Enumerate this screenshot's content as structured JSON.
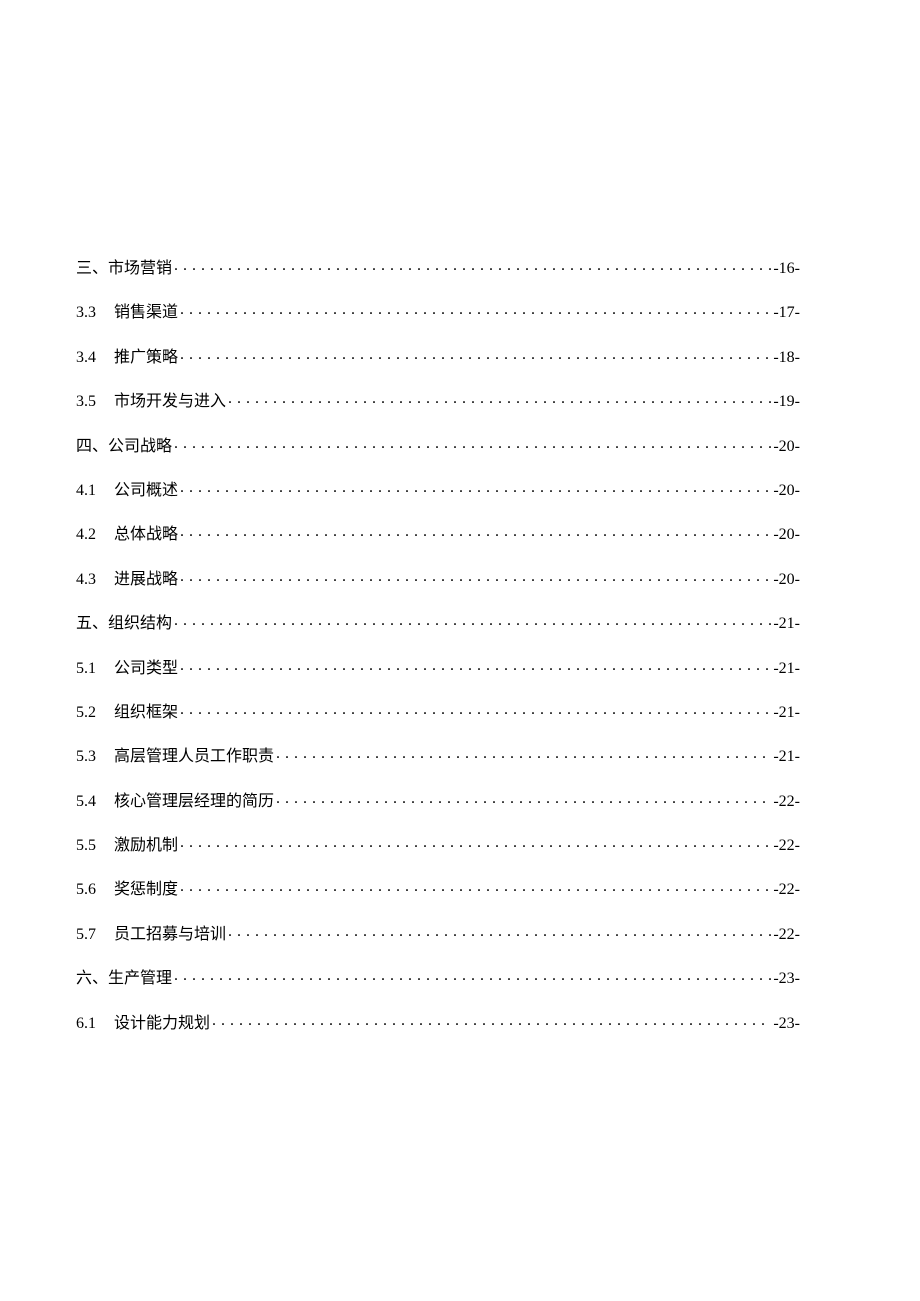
{
  "toc": [
    {
      "number": "三、",
      "title": "市场营销",
      "page": "-16-",
      "hasGap": false
    },
    {
      "number": "3.3",
      "title": "销售渠道",
      "page": "-17-",
      "hasGap": true
    },
    {
      "number": "3.4",
      "title": "推广策略",
      "page": "-18-",
      "hasGap": true
    },
    {
      "number": "3.5",
      "title": "市场开发与进入",
      "page": "-19-",
      "hasGap": true
    },
    {
      "number": "四、",
      "title": "公司战略",
      "page": "-20-",
      "hasGap": false
    },
    {
      "number": "4.1",
      "title": "公司概述",
      "page": "-20-",
      "hasGap": true
    },
    {
      "number": "4.2",
      "title": "总体战略",
      "page": "-20-",
      "hasGap": true
    },
    {
      "number": "4.3",
      "title": "进展战略",
      "page": "-20-",
      "hasGap": true
    },
    {
      "number": "五、",
      "title": "组织结构",
      "page": "-21-",
      "hasGap": false
    },
    {
      "number": "5.1",
      "title": "公司类型",
      "page": "-21-",
      "hasGap": true
    },
    {
      "number": "5.2",
      "title": "组织框架",
      "page": "-21-",
      "hasGap": true
    },
    {
      "number": "5.3",
      "title": "高层管理人员工作职责",
      "page": "-21-",
      "hasGap": true
    },
    {
      "number": "5.4",
      "title": "核心管理层经理的简历",
      "page": "-22-",
      "hasGap": true
    },
    {
      "number": "5.5",
      "title": "激励机制",
      "page": "-22-",
      "hasGap": true
    },
    {
      "number": "5.6",
      "title": "奖惩制度",
      "page": "-22-",
      "hasGap": true
    },
    {
      "number": "5.7",
      "title": "员工招募与培训",
      "page": "-22-",
      "hasGap": true
    },
    {
      "number": "六、",
      "title": "生产管理",
      "page": "-23-",
      "hasGap": false
    },
    {
      "number": "6.1",
      "title": "设计能力规划",
      "page": "-23-",
      "hasGap": true
    }
  ]
}
